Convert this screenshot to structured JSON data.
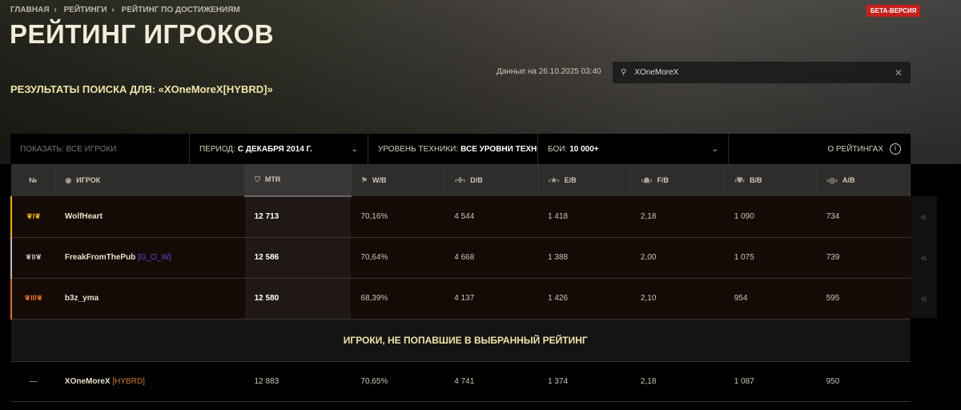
{
  "breadcrumbs": [
    "ГЛАВНАЯ",
    "РЕЙТИНГИ",
    "РЕЙТИНГ ПО ДОСТИЖЕНИЯМ"
  ],
  "title": "РЕЙТИНГ ИГРОКОВ",
  "subtitle": "РЕЗУЛЬТАТЫ ПОИСКА ДЛЯ: «XOneMoreX[HYBRD]»",
  "beta": "БЕТА-ВЕРСИЯ",
  "date": "Данные на 26.10.2025 03:40",
  "search": {
    "value": "XOneMoreX",
    "clear": "✕"
  },
  "filters": {
    "show_label": "ПОКАЗАТЬ: ВСЕ ИГРОКИ",
    "period_label": "ПЕРИОД:",
    "period_value": "С ДЕКАБРЯ 2014 Г.",
    "tier_label": "УРОВЕНЬ ТЕХНИКИ:",
    "tier_value": "ВСЕ УРОВНИ ТЕХНИК",
    "battles_label": "БОИ:",
    "battles_value": "10 000+",
    "about": "О РЕЙТИНГАХ"
  },
  "columns": [
    "№",
    "ИГРОК",
    "MTR",
    "W/B",
    "D/B",
    "E/B",
    "F/B",
    "B/B",
    "A/B"
  ],
  "rows": [
    {
      "rank": "I",
      "color": "#f0b400",
      "name": "WolfHeart",
      "clan": "",
      "mtr": "12 713",
      "wb": "70,16%",
      "db": "4 544",
      "eb": "1 418",
      "fb": "2,18",
      "bb": "1 090",
      "ab": "734"
    },
    {
      "rank": "II",
      "color": "#bbbbbb",
      "name": "FreakFromThePub",
      "clan": "[G_O_W]",
      "clan_color": "#6a3cd0",
      "mtr": "12 586",
      "wb": "70,64%",
      "db": "4 668",
      "eb": "1 388",
      "fb": "2,00",
      "bb": "1 075",
      "ab": "739"
    },
    {
      "rank": "III",
      "color": "#e07020",
      "name": "b3z_yma",
      "clan": "",
      "mtr": "12 580",
      "wb": "68,39%",
      "db": "4 137",
      "eb": "1 426",
      "fb": "2,10",
      "bb": "954",
      "ab": "595"
    }
  ],
  "section": "ИГРОКИ, НЕ ПОПАВШИЕ В ВЫБРАННЫЙ РЕЙТИНГ",
  "unranked": {
    "rank": "—",
    "name": "XOneMoreX",
    "clan": "[HYBRD]",
    "clan_color": "#d07a20",
    "mtr": "12 883",
    "wb": "70,65%",
    "db": "4 741",
    "eb": "1 374",
    "fb": "2,18",
    "bb": "1 087",
    "ab": "950"
  },
  "expand": "«"
}
